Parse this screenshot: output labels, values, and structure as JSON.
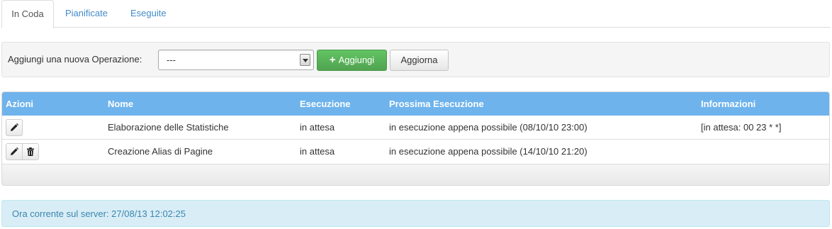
{
  "tabs": [
    {
      "label": "In Coda",
      "active": true
    },
    {
      "label": "Pianificate",
      "active": false
    },
    {
      "label": "Eseguite",
      "active": false
    }
  ],
  "toolbar": {
    "label": "Aggiungi una nuova Operazione:",
    "select_value": "---",
    "add_label": "Aggiungi",
    "refresh_label": "Aggiorna"
  },
  "table": {
    "headers": [
      "Azioni",
      "Nome",
      "Esecuzione",
      "Prossima Esecuzione",
      "Informazioni"
    ],
    "rows": [
      {
        "actions": [
          "pencil-icon"
        ],
        "name": "Elaborazione delle Statistiche",
        "execution": "in attesa",
        "next_execution": "in esecuzione appena possibile (08/10/10 23:00)",
        "info": "[in attesa: 00 23 * *]"
      },
      {
        "actions": [
          "pencil-icon",
          "trash-icon"
        ],
        "name": "Creazione Alias di Pagine",
        "execution": "in attesa",
        "next_execution": "in esecuzione appena possibile (14/10/10 21:20)",
        "info": ""
      }
    ]
  },
  "alert": {
    "text": "Ora corrente sul server: 27/08/13 12:02:25"
  },
  "colors": {
    "header_bg": "#6eb3ec",
    "add_button": "#5cb85c",
    "alert_bg": "#d9edf7",
    "link": "#428bca"
  }
}
